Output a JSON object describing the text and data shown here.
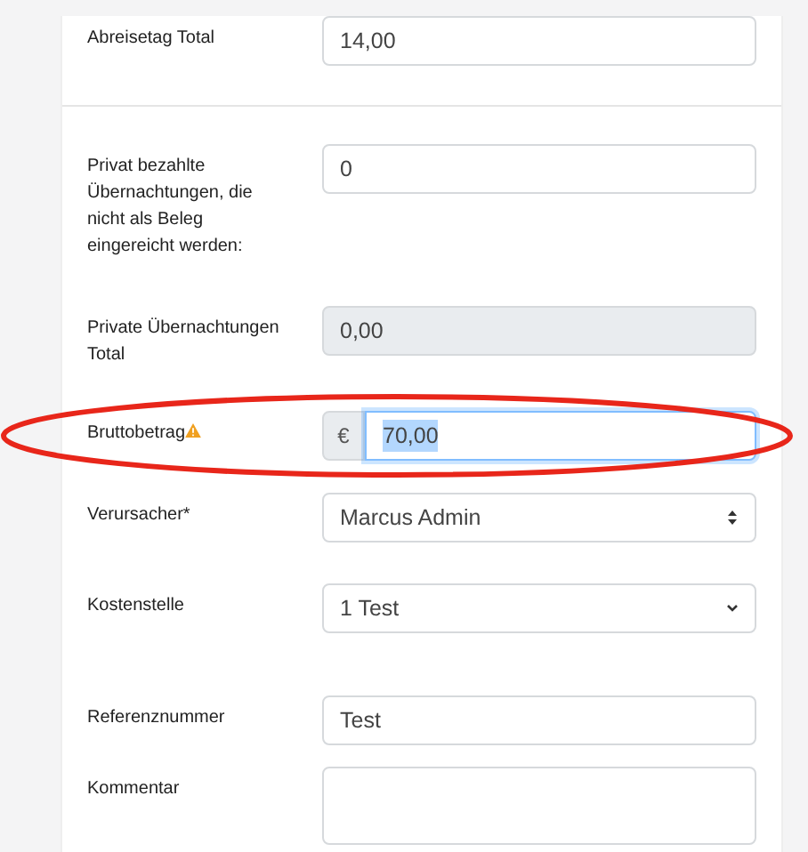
{
  "sections": [
    {
      "fields": [
        {
          "label": "Abreisetag Total",
          "kind": "input",
          "value": "14,00",
          "highlighted": false
        }
      ]
    },
    {
      "fields": [
        {
          "label": "Privat bezahlte Übernachtungen, die nicht als Beleg eingereicht werden:",
          "kind": "input",
          "value": "0",
          "highlighted": false
        },
        {
          "label": "Private Übernachtungen Total",
          "kind": "readonly",
          "value": "0,00",
          "highlighted": false
        },
        {
          "label": "Bruttobetrag",
          "kind": "currency",
          "prefix": "€",
          "value": "70,00",
          "warning": true,
          "focused": true,
          "highlighted": true
        },
        {
          "label": "Verursacher*",
          "kind": "stepper-select",
          "value": "Marcus Admin",
          "highlighted": false
        },
        {
          "label": "Kostenstelle",
          "kind": "select",
          "value": "1 Test",
          "highlighted": false
        },
        {
          "label": "Referenznummer",
          "kind": "input",
          "value": "Test",
          "highlighted": false
        },
        {
          "label": "Kommentar",
          "kind": "textarea",
          "highlighted": false
        }
      ]
    }
  ]
}
